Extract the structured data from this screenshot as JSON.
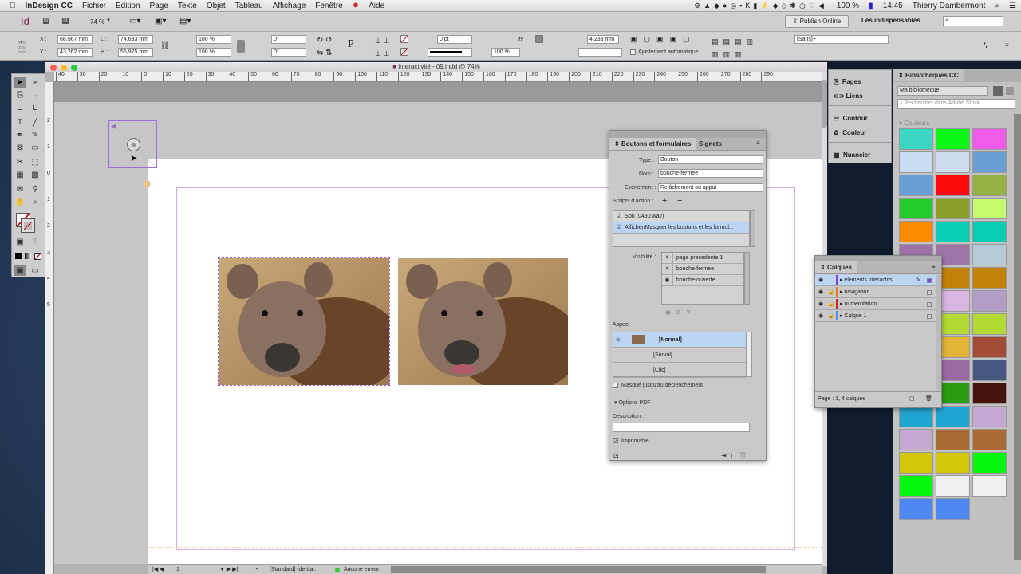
{
  "menubar": {
    "apple": "",
    "app": "InDesign CC",
    "items": [
      "Fichier",
      "Edition",
      "Page",
      "Texte",
      "Objet",
      "Tableau",
      "Affichage",
      "Fenêtre",
      "Aide"
    ],
    "battery": "100 %",
    "time": "14:45",
    "user": "Thierry Dambermont"
  },
  "appbar": {
    "logo": "Id",
    "br": "Br",
    "st": "St",
    "zoom": "74 %",
    "publish": "Publish Online",
    "workspace": "Les indispensables",
    "search_placeholder": ""
  },
  "control": {
    "x_label": "X :",
    "x": "68,567 mm",
    "y_label": "Y :",
    "y": "43,262 mm",
    "w_label": "L :",
    "w": "74,633 mm",
    "h_label": "H :",
    "h": "55,975 mm",
    "scale_x": "100 %",
    "scale_y": "100 %",
    "rotation": "0°",
    "shear": "0°",
    "stroke_weight": "0 pt",
    "opacity": "100 %",
    "offset": "4,233 mm",
    "autofit": "Ajustement automatique",
    "style": "[Sans]+"
  },
  "document": {
    "title": "interactivité - 09.indd @ 74%",
    "hruler": [
      "40",
      "30",
      "20",
      "10",
      "0",
      "10",
      "20",
      "30",
      "40",
      "50",
      "60",
      "70",
      "80",
      "90",
      "100",
      "110",
      "120",
      "130",
      "140",
      "150",
      "160",
      "170",
      "180",
      "190",
      "200",
      "210",
      "220",
      "230",
      "240",
      "250",
      "260",
      "270",
      "280",
      "290"
    ],
    "vruler": [
      "2",
      "1",
      "0",
      "1",
      "2",
      "3",
      "4",
      "5"
    ]
  },
  "status": {
    "page": "1",
    "preflight_profile": "[Standard] (de tra...",
    "errors": "Aucune erreur"
  },
  "buttons_panel": {
    "tabs": [
      "Boutons et formulaires",
      "Signets"
    ],
    "type_label": "Type :",
    "type": "Bouton",
    "name_label": "Nom :",
    "name": "bouche-fermee",
    "event_label": "Evénement :",
    "event": "Relâchement ou appui",
    "scripts_label": "Scripts d'action :",
    "add": "+",
    "remove": "−",
    "actions": [
      {
        "label": "Son (0490.wav)",
        "checked": true
      },
      {
        "label": "Afficher/Masquer les boutons et les formul...",
        "checked": true
      }
    ],
    "visibility_label": "Visibilité :",
    "visibility": [
      {
        "icon": "x-icon",
        "glyph": "✕",
        "label": "page precedente 1"
      },
      {
        "icon": "x-icon",
        "glyph": "✕",
        "label": "bouche-fermee"
      },
      {
        "icon": "eye-icon",
        "glyph": "◉",
        "label": "bouche-ouverte"
      }
    ],
    "aspect_label": "Aspect",
    "states": [
      "[Normal]",
      "[Survol]",
      "[Clic]"
    ],
    "hidden_until": "Masqué jusqu'au déclenchement",
    "pdf_options": "Options PDF",
    "description_label": "Description :",
    "description": "",
    "printable": "Imprimable"
  },
  "dock": [
    "Pages",
    "Liens",
    "Contour",
    "Couleur",
    "Nuancier"
  ],
  "libraries": {
    "title": "Bibliothèques CC",
    "library": "Ma bibliothèque",
    "search_placeholder": "Rechercher dans Adobe Stock",
    "section": "Couleurs",
    "colors": [
      "#3dd6c4",
      "#0bf614",
      "#f25ae8",
      "#c9dbf0",
      "#cddcec",
      "#6a9fd6",
      "#6a9fd6",
      "#ff0a0a",
      "#97b145",
      "#24c92c",
      "#8ba02b",
      "#c6fb70",
      "#ff8c00",
      "#08cdb4",
      "#08cdb4",
      "#9e73a8",
      "#9e73a8",
      "#b6c9d6",
      "#c38207",
      "#c38207",
      "#c38207",
      "#d9b5e3",
      "#d9b5e3",
      "#b39dc6",
      "#b3da34",
      "#b3da34",
      "#b3da34",
      "#e2b538",
      "#e2b538",
      "#a24c38",
      "#9a6aa2",
      "#9a6aa2",
      "#485781",
      "#5e7f63",
      "#2a9b12",
      "#46130c",
      "#20a5d2",
      "#20a5d2",
      "#c4a8d2",
      "#c4a8d2",
      "#a96a34",
      "#a96a34",
      "#d4c70a",
      "#d4c70a",
      "#05f80c",
      "#05f80c",
      "#f0f0f0",
      "#f0f0f0",
      "#4d88f5",
      "#4d88f5"
    ]
  },
  "layers": {
    "title": "Calques",
    "items": [
      {
        "name": "elements interactifs",
        "color": "#8a3cf0",
        "locked": false
      },
      {
        "name": "navigation",
        "color": "#f07820",
        "locked": true
      },
      {
        "name": "numerotation",
        "color": "#d42020",
        "locked": true
      },
      {
        "name": "Calque 1",
        "color": "#4a90f0",
        "locked": true
      }
    ],
    "footer": "Page : 1, 4 calques"
  }
}
